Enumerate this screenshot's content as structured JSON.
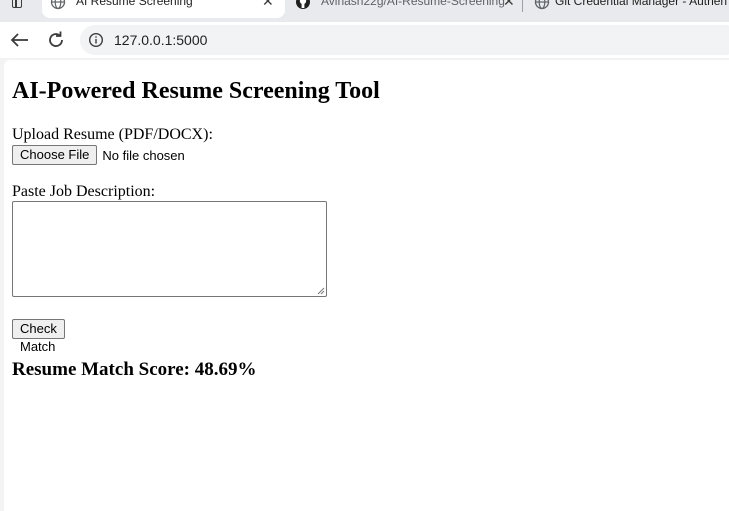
{
  "browser": {
    "tabs": [
      {
        "title": "AI Resume Screening",
        "active": true,
        "icon": "globe-icon"
      },
      {
        "title": "Avinash22g/AI-Resume-Screening",
        "active": false,
        "icon": "github-icon"
      },
      {
        "title": "Git Credential Manager - Authen",
        "active": false,
        "icon": "globe-icon"
      }
    ],
    "address": "127.0.0.1:5000",
    "colors": {
      "tabstrip": "#e8eaed",
      "omnibox": "#f1f3f4",
      "icon": "#3c3c3c"
    }
  },
  "page": {
    "heading": "AI-Powered Resume Screening Tool",
    "upload_label": "Upload Resume (PDF/DOCX):",
    "choose_file_label": "Choose File",
    "file_status": "No file chosen",
    "jd_label": "Paste Job Description:",
    "jd_value": "",
    "check_button_label": "Check Match",
    "score_text": "Resume Match Score: 48.69%"
  }
}
